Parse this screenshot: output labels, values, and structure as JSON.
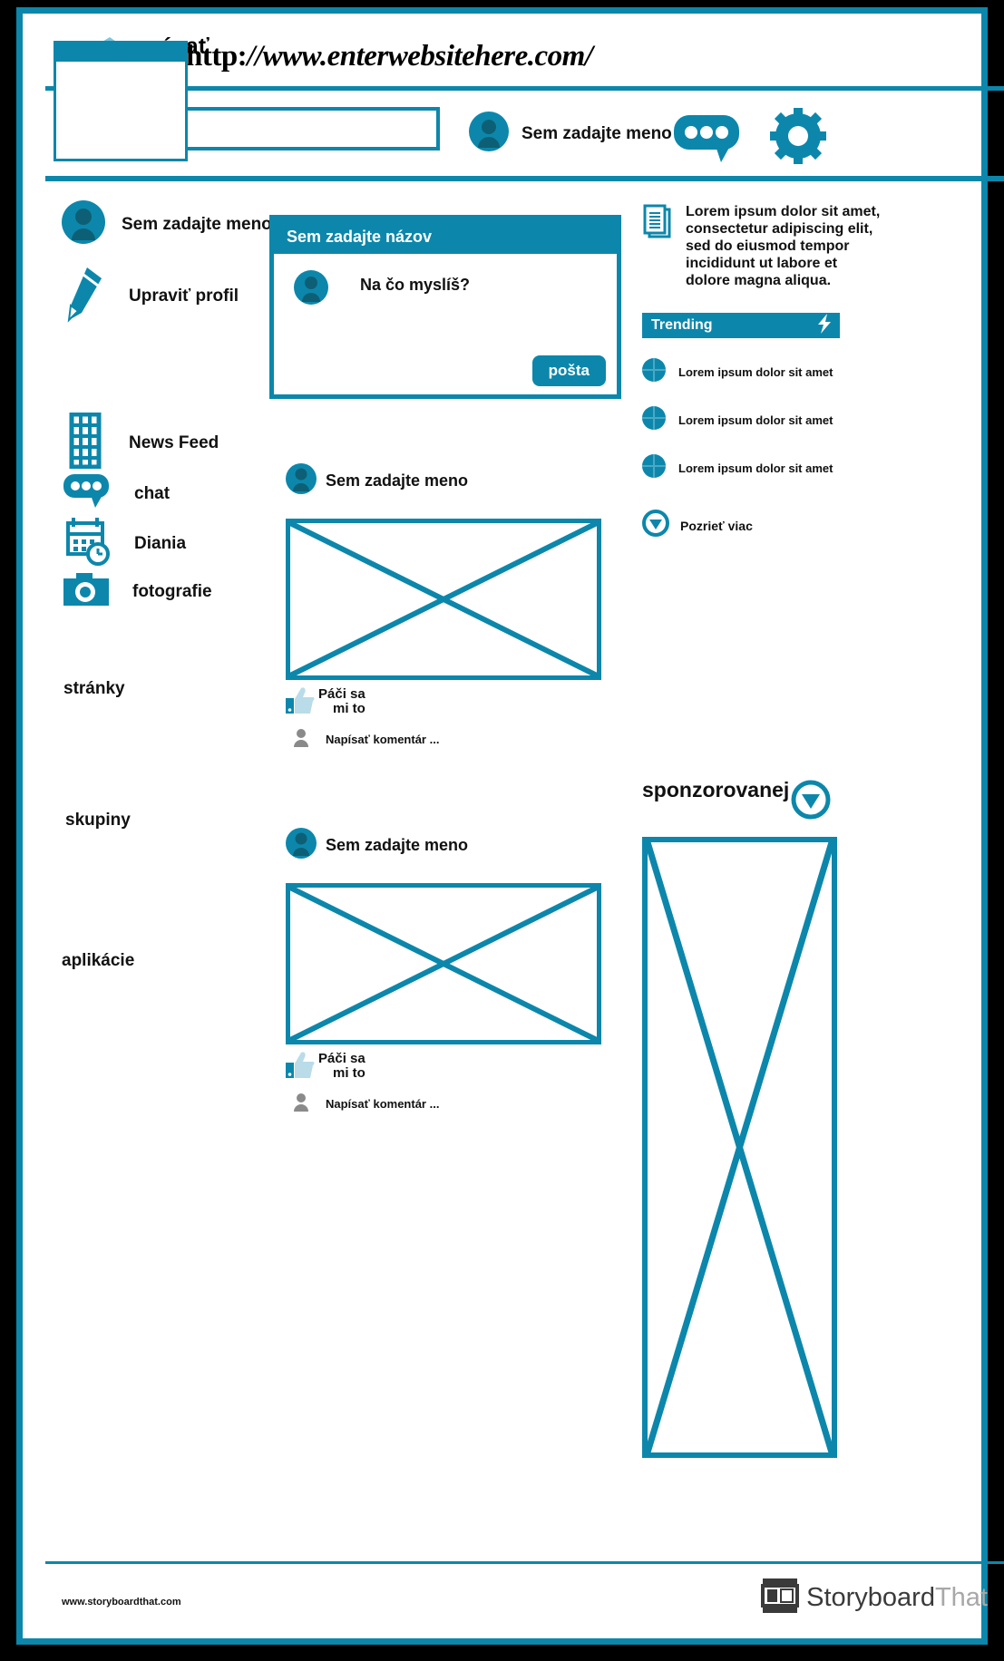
{
  "browser": {
    "url": "http://www.enterwebsitehere.com/",
    "url_prefix": "http:",
    "url_rest": "//www.enterwebsitehere.com/"
  },
  "toolbar": {
    "search_value": "ávať",
    "search_placeholder": "Vyhľadávať",
    "user_name": "Sem zadajte meno",
    "chat_icon": "chat-bubble-icon",
    "settings_icon": "gear-icon"
  },
  "sidebar": {
    "profile_name": "Sem zadajte meno",
    "edit_profile": "Upraviť profil",
    "items": [
      {
        "label": "News Feed",
        "icon": "building-icon"
      },
      {
        "label": "chat",
        "icon": "chat-bubble-icon"
      },
      {
        "label": "Diania",
        "icon": "calendar-clock-icon"
      },
      {
        "label": "fotografie",
        "icon": "camera-icon"
      }
    ],
    "sections": [
      {
        "label": "stránky"
      },
      {
        "label": "skupiny"
      },
      {
        "label": "aplikácie"
      }
    ]
  },
  "composer": {
    "title": "Sem zadajte názov",
    "prompt": "Na čo myslíš?",
    "post_button": "pošta"
  },
  "posts": [
    {
      "author": "Sem zadajte meno",
      "like_label": "Páči sa\nmi to",
      "like_line1": "Páči sa",
      "like_line2": "mi to",
      "comment_placeholder": "Napísať komentár ..."
    },
    {
      "author": "Sem zadajte meno",
      "like_label": "Páči sa\nmi to",
      "like_line1": "Páči sa",
      "like_line2": "mi to",
      "comment_placeholder": "Napísať komentár ..."
    }
  ],
  "rightbar": {
    "lorem": "Lorem ipsum dolor sit amet, consectetur adipiscing elit, sed do eiusmod tempor incididunt ut labore et dolore magna aliqua.",
    "document_icon": "documents-icon",
    "trending_title": "Trending",
    "trending_icon": "lightning-bolt-icon",
    "trending_items": [
      "Lorem ipsum dolor sit amet",
      "Lorem ipsum dolor sit amet",
      "Lorem ipsum dolor sit amet"
    ],
    "see_more": "Pozrieť viac",
    "see_more_icon": "chevron-down-circle-icon"
  },
  "sponsored": {
    "title": "sponzorovanej",
    "collapse_icon": "chevron-down-circle-icon"
  },
  "footer": {
    "url": "www.storyboardthat.com",
    "logo_part1": "Storyboard",
    "logo_part2": "That",
    "logo_icon": "storyboard-frames-icon"
  },
  "colors": {
    "accent": "#0c87ab",
    "accent_dark": "#0d5f75",
    "white": "#ffffff",
    "black": "#000000",
    "grey": "#8a8a8a"
  }
}
